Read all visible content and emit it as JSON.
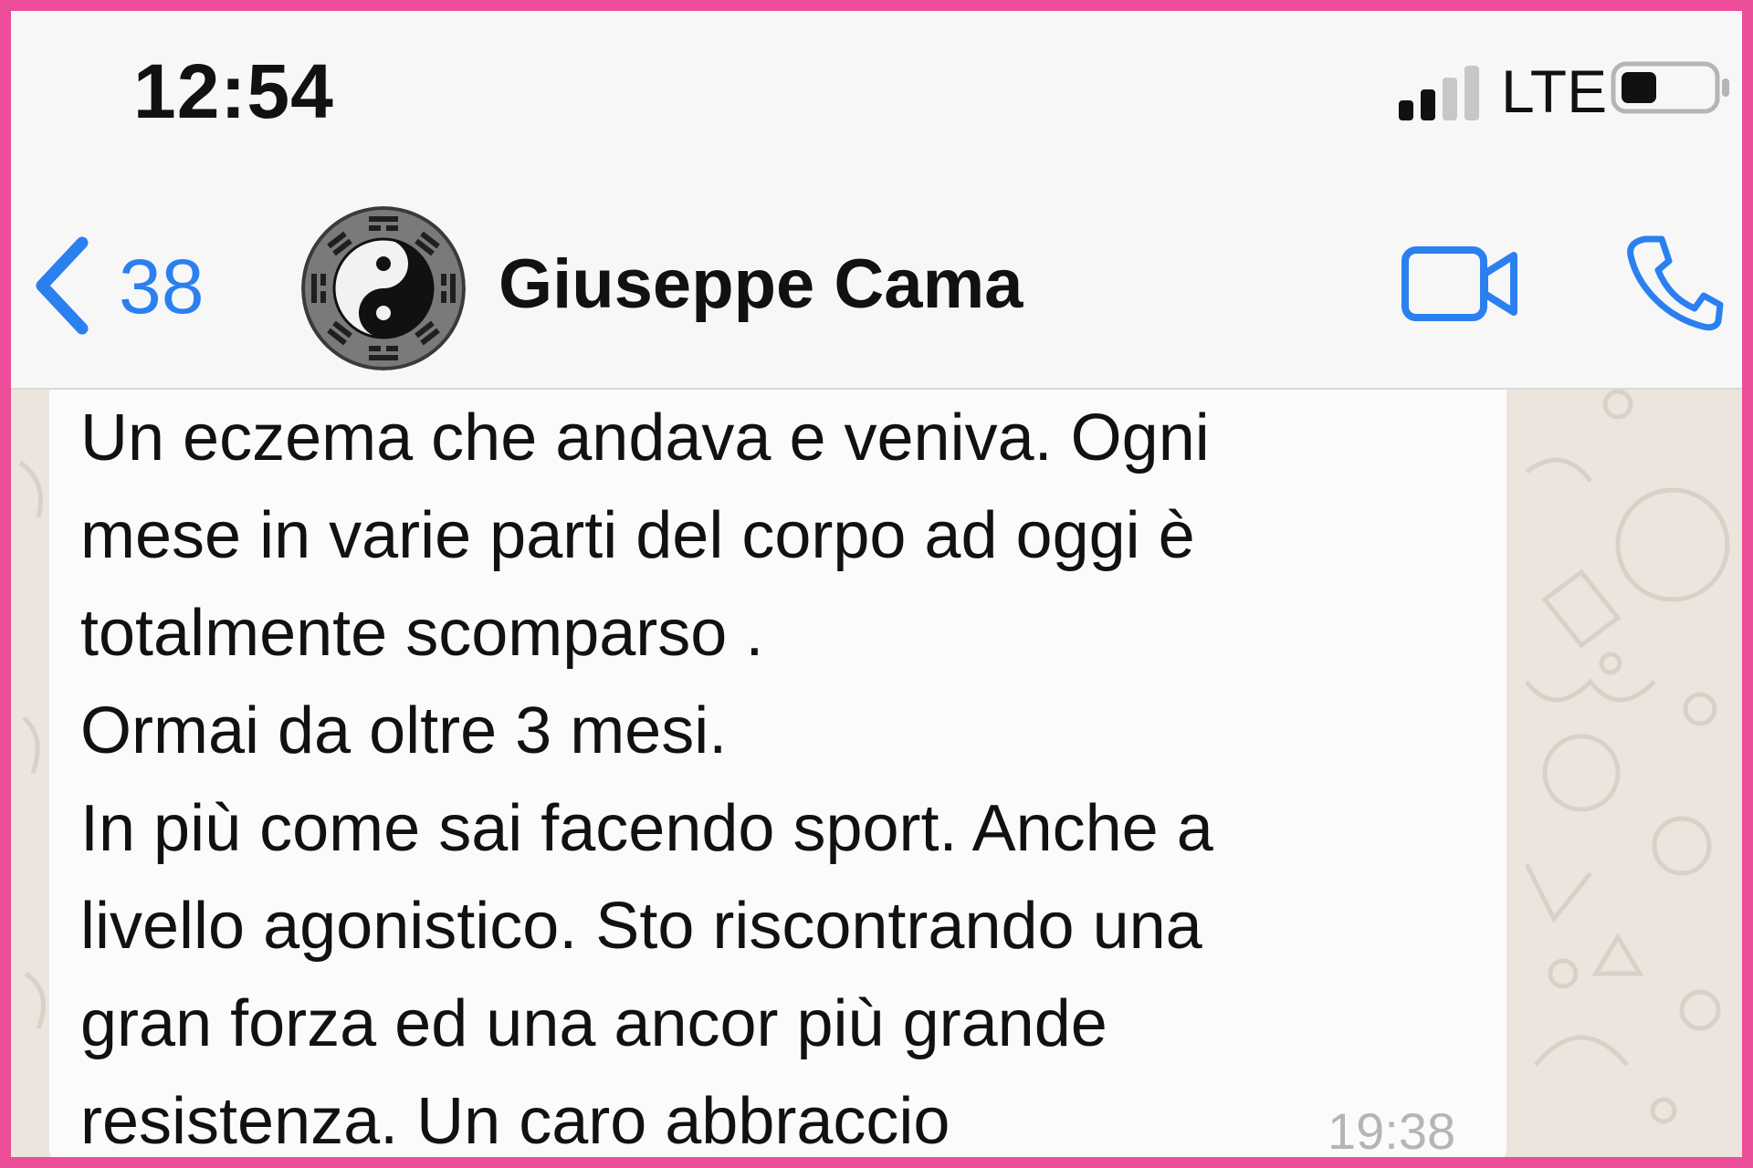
{
  "status_bar": {
    "time": "12:54",
    "network": "LTE",
    "signal_icon": "cellular-signal-icon",
    "battery_icon": "battery-icon",
    "battery_level": 0.4
  },
  "header": {
    "back_count": "38",
    "back_icon": "chevron-left-icon",
    "avatar_icon": "yin-yang-bagua-icon",
    "contact_name": "Giuseppe Cama",
    "video_icon": "video-camera-icon",
    "call_icon": "phone-icon"
  },
  "message": {
    "text": "Un eczema che andava e veniva. Ogni\nmese in varie parti del corpo ad oggi è\ntotalmente scomparso .\nOrmai da oltre 3 mesi.\nIn più come sai facendo sport. Anche a\nlivello agonistico. Sto riscontrando una\ngran forza ed una ancor più grande\nresistenza. Un caro abbraccio",
    "time": "19:38"
  },
  "colors": {
    "accent": "#2b80f0",
    "frame_border": "#ec4d98",
    "chat_background": "#ece5dd",
    "bubble": "#fbfbfb"
  }
}
